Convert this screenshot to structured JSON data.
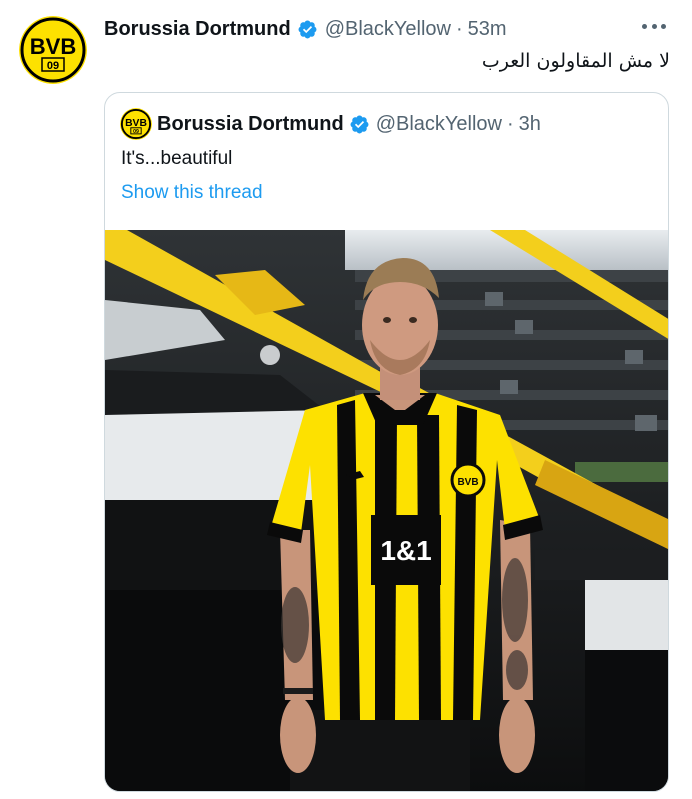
{
  "tweet": {
    "author_name": "Borussia Dortmund",
    "handle": "@BlackYellow",
    "separator": "·",
    "time": "53m",
    "text": "لا مش المقاولون العرب",
    "more_icon": "more-options-icon",
    "verified_icon": "verified-badge-icon"
  },
  "quoted": {
    "author_name": "Borussia Dortmund",
    "handle": "@BlackYellow",
    "separator": "·",
    "time": "3h",
    "text": "It's...beautiful",
    "thread_link": "Show this thread"
  },
  "logo": {
    "letters_top": "BVB",
    "letters_bottom": "09"
  },
  "jersey": {
    "sponsor": "1&1"
  },
  "colors": {
    "bvb_yellow": "#fde100",
    "bvb_black": "#000000",
    "verified_blue": "#1d9bf0",
    "link_blue": "#1d9bf0",
    "secondary_text": "#536471",
    "border": "#cfd9de"
  }
}
